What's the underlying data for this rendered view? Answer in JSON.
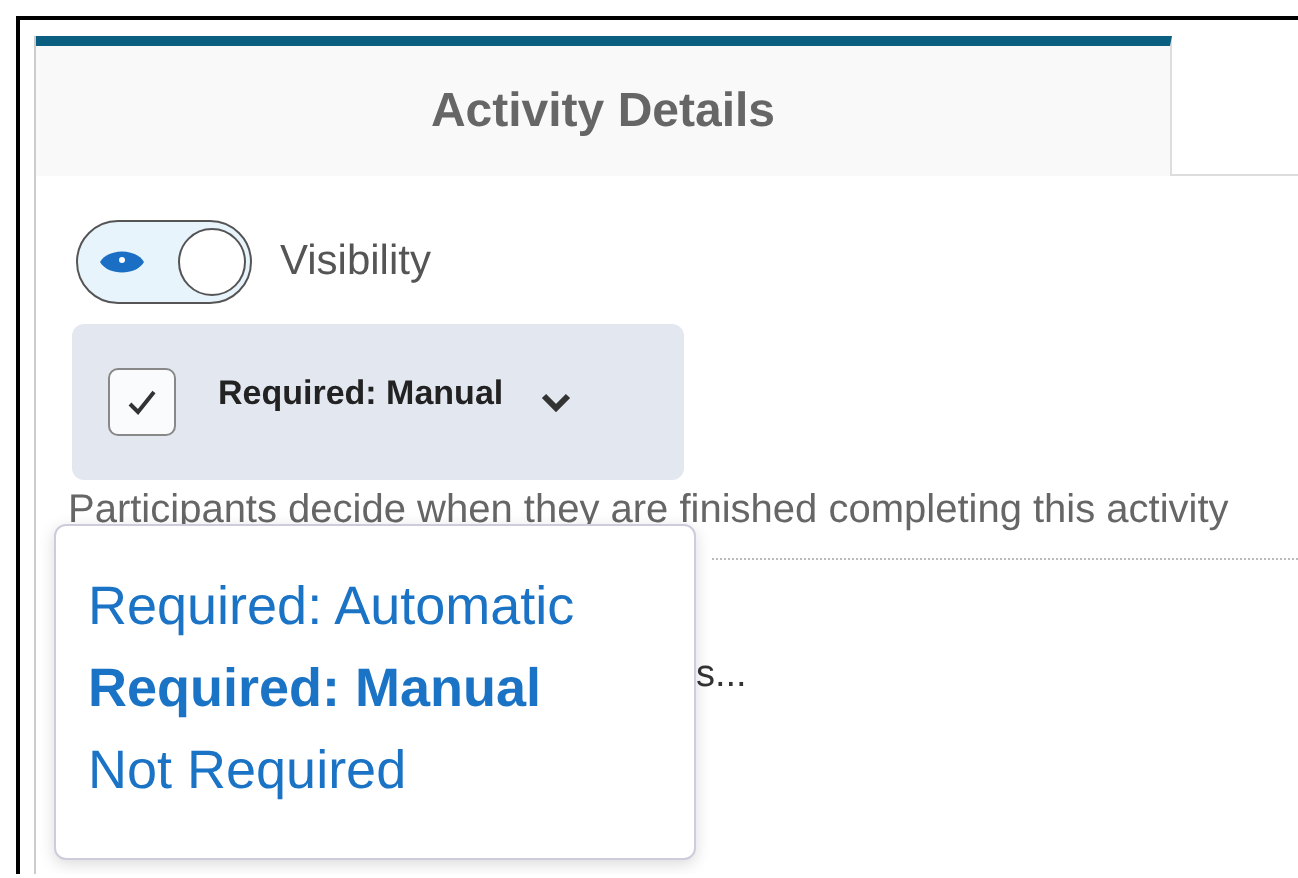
{
  "tabs": [
    {
      "label": "Activity Details",
      "selected": true
    }
  ],
  "visibility": {
    "label": "Visibility",
    "on": true
  },
  "completion": {
    "label": "Required: Manual",
    "checked": true,
    "description": "Participants decide when they are finished completing this activity"
  },
  "menu": {
    "items": [
      {
        "label": "Required: Automatic",
        "selected": false
      },
      {
        "label": "Required: Manual",
        "selected": true
      },
      {
        "label": "Not Required",
        "selected": false
      }
    ]
  },
  "hidden_text": "s..."
}
